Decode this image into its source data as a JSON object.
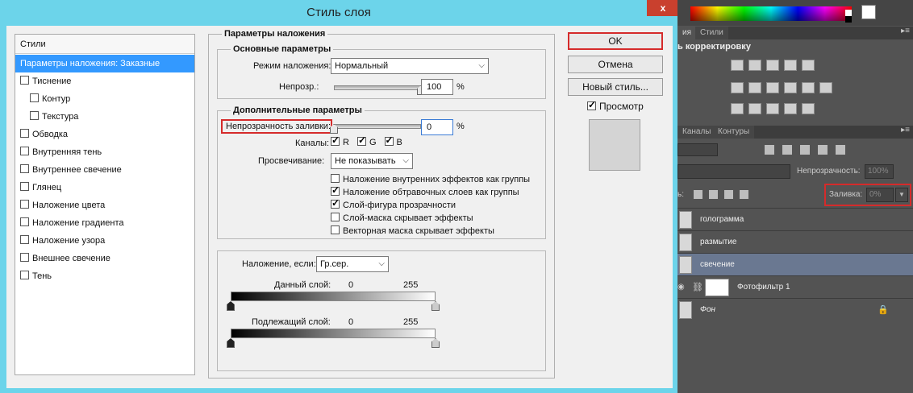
{
  "dialog": {
    "title": "Стиль слоя",
    "close_label": "x",
    "styles_header": "Стили",
    "styles": [
      {
        "label": "Параметры наложения: Заказные",
        "checkbox": false,
        "selected": true
      },
      {
        "label": "Тиснение",
        "checkbox": true,
        "checked": false
      },
      {
        "label": "Контур",
        "checkbox": true,
        "checked": false,
        "indent": true
      },
      {
        "label": "Текстура",
        "checkbox": true,
        "checked": false,
        "indent": true
      },
      {
        "label": "Обводка",
        "checkbox": true,
        "checked": false
      },
      {
        "label": "Внутренняя тень",
        "checkbox": true,
        "checked": false
      },
      {
        "label": "Внутреннее свечение",
        "checkbox": true,
        "checked": false
      },
      {
        "label": "Глянец",
        "checkbox": true,
        "checked": false
      },
      {
        "label": "Наложение цвета",
        "checkbox": true,
        "checked": false
      },
      {
        "label": "Наложение градиента",
        "checkbox": true,
        "checked": false
      },
      {
        "label": "Наложение узора",
        "checkbox": true,
        "checked": false
      },
      {
        "label": "Внешнее свечение",
        "checkbox": true,
        "checked": false
      },
      {
        "label": "Тень",
        "checkbox": true,
        "checked": false
      }
    ],
    "blending": {
      "title": "Параметры наложения",
      "general_title": "Основные параметры",
      "blend_mode_label": "Режим наложения:",
      "blend_mode_value": "Нормальный",
      "opacity_label": "Непрозр.:",
      "opacity_value": "100",
      "opacity_pct": 1.0,
      "percent": "%",
      "advanced_title": "Дополнительные параметры",
      "fill_opacity_label": "Непрозрачность заливки:",
      "fill_opacity_value": "0",
      "fill_opacity_pct": 0.0,
      "channels_label": "Каналы:",
      "channels": [
        {
          "label": "R",
          "checked": true
        },
        {
          "label": "G",
          "checked": true
        },
        {
          "label": "B",
          "checked": true
        }
      ],
      "knockout_label": "Просвечивание:",
      "knockout_value": "Не показывать",
      "options": [
        {
          "label": "Наложение внутренних эффектов как группы",
          "checked": false
        },
        {
          "label": "Наложение обтравочных слоев как группы",
          "checked": true
        },
        {
          "label": "Слой-фигура прозрачности",
          "checked": true
        },
        {
          "label": "Слой-маска скрывает эффекты",
          "checked": false
        },
        {
          "label": "Векторная маска скрывает эффекты",
          "checked": false
        }
      ],
      "blend_if_label": "Наложение, если:",
      "blend_if_value": "Гр.сер.",
      "this_layer_label": "Данный слой:",
      "underlying_label": "Подлежащий слой:",
      "range_min": "0",
      "range_max": "255"
    },
    "buttons": {
      "ok": "OK",
      "cancel": "Отмена",
      "new_style": "Новый стиль...",
      "preview": "Просмотр",
      "preview_checked": true
    }
  },
  "photoshop": {
    "top_tabs": [
      "ия",
      "Стили"
    ],
    "adjustments_title": "ь корректировку",
    "lower_tabs": [
      "Каналы",
      "Контуры"
    ],
    "opacity_label": "Непрозрачность:",
    "opacity_value": "100%",
    "fill_label": "Заливка:",
    "fill_value": "0%",
    "lock_prefix": "ь:",
    "layers": [
      {
        "name": "голограмма",
        "type": "normal",
        "selected": false
      },
      {
        "name": "размытие",
        "type": "normal",
        "selected": false
      },
      {
        "name": "свечение",
        "type": "normal",
        "selected": true
      },
      {
        "name": "Фотофильтр 1",
        "type": "adjustment",
        "selected": false
      },
      {
        "name": "Фон",
        "type": "background",
        "selected": false
      }
    ],
    "colors": {
      "accent_red": "#d52b2b",
      "selection_blue": "#3399ff",
      "title_bar": "#6cd4ea",
      "selected_layer": "#6a7891"
    }
  }
}
